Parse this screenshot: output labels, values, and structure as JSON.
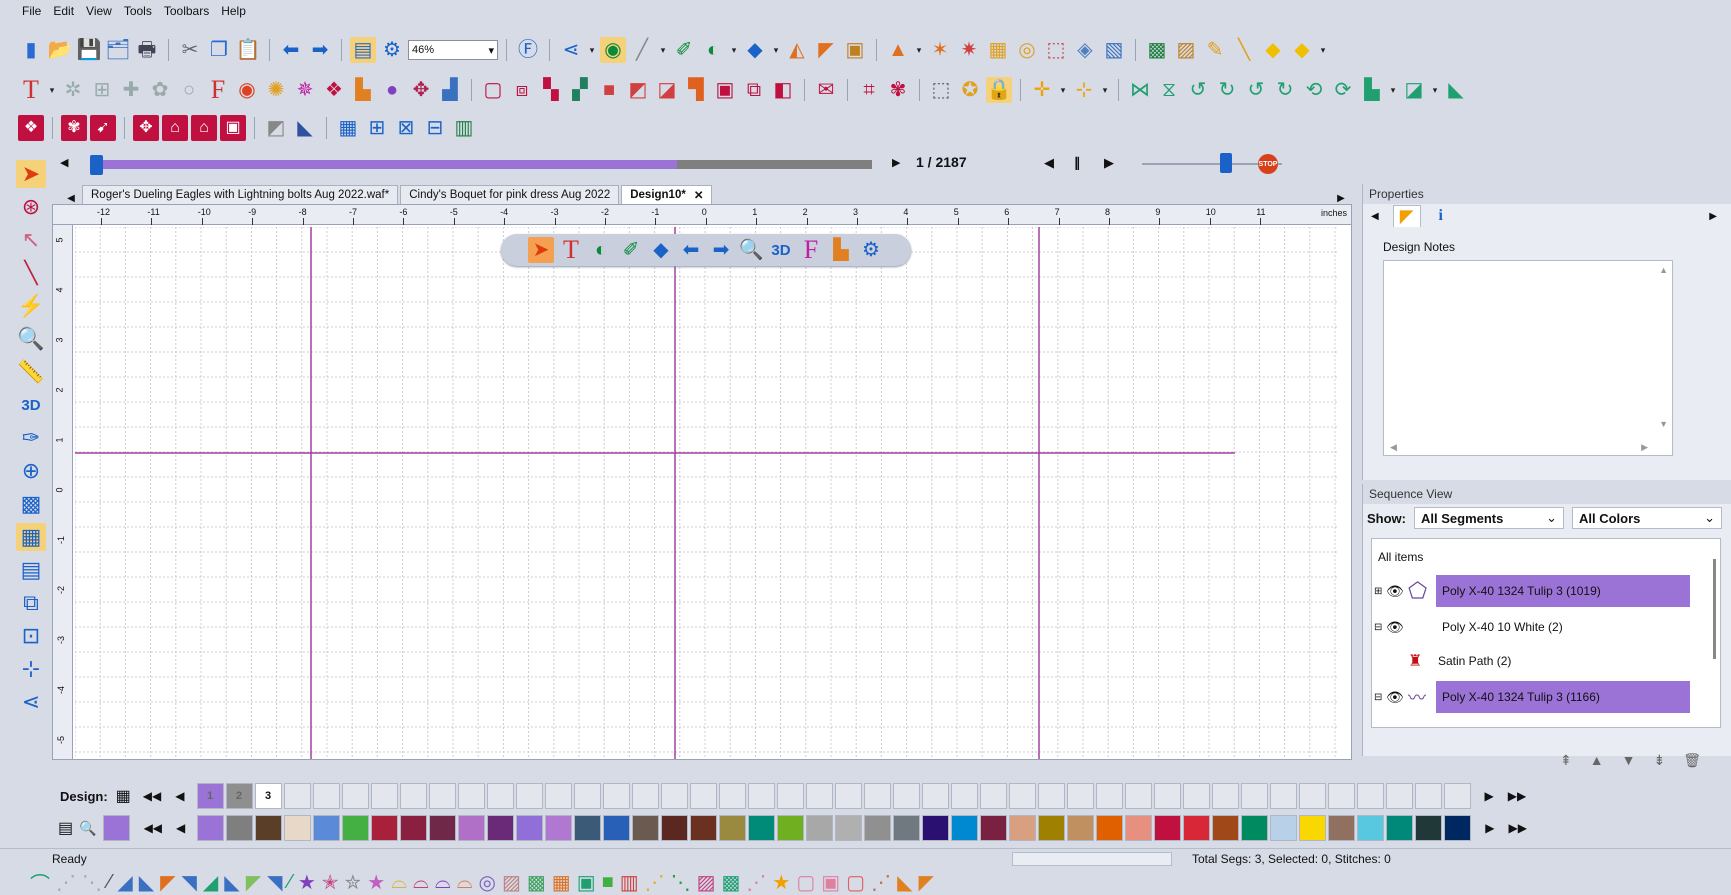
{
  "menu": [
    "File",
    "Edit",
    "View",
    "Tools",
    "Toolbars",
    "Help"
  ],
  "zoom": "46%",
  "playback": {
    "counter": "1 / 2187",
    "progress": 0.75
  },
  "tabs": [
    "Roger's Dueling Eagles with Lightning bolts Aug 2022.waf*",
    "Cindy's Boquet for pink dress Aug 2022",
    "Design10*"
  ],
  "ruler": {
    "unit": "inches",
    "h_ticks": [
      "-12",
      "-11",
      "-10",
      "-9",
      "-8",
      "-7",
      "-6",
      "-5",
      "-4",
      "-3",
      "-2",
      "-1",
      "0",
      "1",
      "2",
      "3",
      "4",
      "5",
      "6",
      "7",
      "8",
      "9",
      "10",
      "11"
    ],
    "v_ticks": [
      "5",
      "4",
      "3",
      "2",
      "1",
      "0",
      "-1",
      "-2",
      "-3",
      "-4",
      "-5"
    ]
  },
  "properties": {
    "title": "Properties",
    "notes_label": "Design Notes"
  },
  "sequence": {
    "title": "Sequence View",
    "show_label": "Show:",
    "filter_segments": "All Segments",
    "filter_colors": "All Colors",
    "root": "All items",
    "items": [
      {
        "label": "Poly X-40 1324 Tulip 3 (1019)",
        "highlight": true
      },
      {
        "label": "Poly X-40 10 White (2)",
        "highlight": false
      },
      {
        "label": "Satin Path (2)",
        "highlight": false
      },
      {
        "label": "Poly X-40 1324 Tulip 3 (1166)",
        "highlight": true
      }
    ]
  },
  "colorbar": {
    "design_label": "Design:",
    "design_swatches": [
      {
        "label": "1",
        "color": "#9b72d6"
      },
      {
        "label": "2",
        "color": "#8f8f8f"
      },
      {
        "label": "3",
        "color": "#ffffff"
      }
    ],
    "palette": [
      "#9b72d6",
      "#7f7f7f",
      "#5a3e28",
      "#e8d8c8",
      "#5a8ad8",
      "#44b044",
      "#a8203a",
      "#8a2040",
      "#702848",
      "#b070c8",
      "#6a2a78",
      "#9070d8",
      "#b078d0",
      "#3a5a78",
      "#2860b8",
      "#6a5a50",
      "#5a2820",
      "#6a3020",
      "#9a8a40",
      "#008a78",
      "#70b020",
      "#a8a8a8",
      "#b0b0b0",
      "#909090",
      "#707880",
      "#2a1070",
      "#0088d0",
      "#7a2040",
      "#d8a080",
      "#a08000",
      "#c09060",
      "#e06000",
      "#e89080",
      "#c01040",
      "#d82838",
      "#a04818",
      "#008a60",
      "#b8d0e8",
      "#f8d800",
      "#907060",
      "#58c8e0",
      "#008878",
      "#203838",
      "#002860"
    ]
  },
  "status": {
    "left": "Ready",
    "right": "Total Segs: 3, Selected: 0, Stitches: 0"
  }
}
